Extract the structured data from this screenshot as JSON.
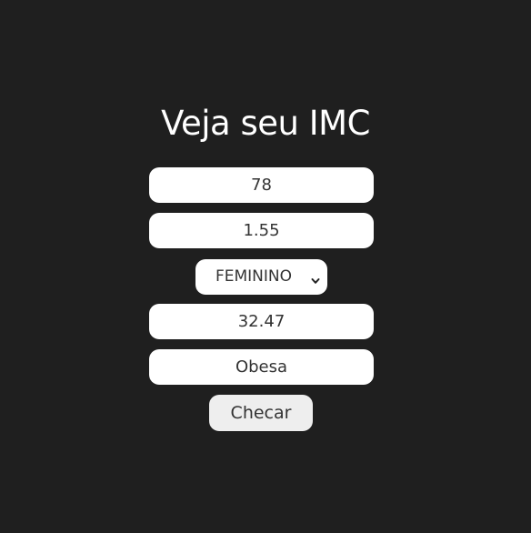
{
  "title": "Veja seu IMC",
  "form": {
    "weight_value": "78",
    "height_value": "1.55",
    "sex_selected": "FEMININO",
    "imc_value": "32.47",
    "classification_value": "Obesa",
    "check_label": "Checar"
  },
  "colors": {
    "background": "#1f1f1f",
    "field": "#ffffff",
    "button": "#eeeeee",
    "text": "#333333"
  }
}
